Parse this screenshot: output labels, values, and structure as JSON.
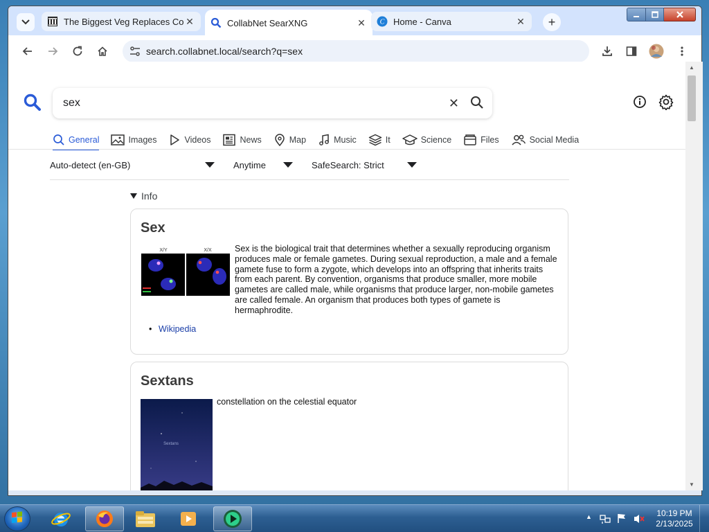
{
  "browser": {
    "tabs": [
      {
        "title": "The Biggest Veg Replaces Colle",
        "favicon": "museum-icon",
        "active": false
      },
      {
        "title": "CollabNet SearXNG",
        "favicon": "search-icon",
        "active": true
      },
      {
        "title": "Home - Canva",
        "favicon": "canva-icon",
        "active": false
      }
    ],
    "url": "search.collabnet.local/search?q=sex"
  },
  "search": {
    "query": "sex",
    "categories": [
      {
        "label": "General",
        "icon": "search-icon",
        "active": true
      },
      {
        "label": "Images",
        "icon": "image-icon"
      },
      {
        "label": "Videos",
        "icon": "play-icon"
      },
      {
        "label": "News",
        "icon": "newspaper-icon"
      },
      {
        "label": "Map",
        "icon": "map-pin-icon"
      },
      {
        "label": "Music",
        "icon": "music-note-icon"
      },
      {
        "label": "It",
        "icon": "layers-icon"
      },
      {
        "label": "Science",
        "icon": "graduation-cap-icon"
      },
      {
        "label": "Files",
        "icon": "files-icon"
      },
      {
        "label": "Social Media",
        "icon": "people-icon"
      }
    ],
    "filters": {
      "language": "Auto-detect (en-GB)",
      "time": "Anytime",
      "safesearch": "SafeSearch: Strict"
    },
    "info_toggle": "Info"
  },
  "infoboxes": [
    {
      "title": "Sex",
      "image_labels": [
        "X/Y",
        "X/X"
      ],
      "description": "Sex is the biological trait that determines whether a sexually reproducing organism produces male or female gametes. During sexual reproduction, a male and a female gamete fuse to form a zygote, which develops into an offspring that inherits traits from each parent. By convention, organisms that produce smaller, more mobile gametes are called male, while organisms that produce larger, non-mobile gametes are called female. An organism that produces both types of gamete is hermaphrodite.",
      "links": [
        "Wikipedia"
      ]
    },
    {
      "title": "Sextans",
      "image_label": "Sextans",
      "description": "constellation on the celestial equator"
    }
  ],
  "taskbar": {
    "apps": [
      "internet-explorer-icon",
      "firefox-icon",
      "file-explorer-icon",
      "media-player-icon",
      "screen-recorder-icon"
    ],
    "clock_time": "10:19 PM",
    "clock_date": "2/13/2025"
  },
  "colors": {
    "accent": "#2a5bd7",
    "tabstrip": "#d3e3fd",
    "omnibox": "#edf2fa"
  }
}
